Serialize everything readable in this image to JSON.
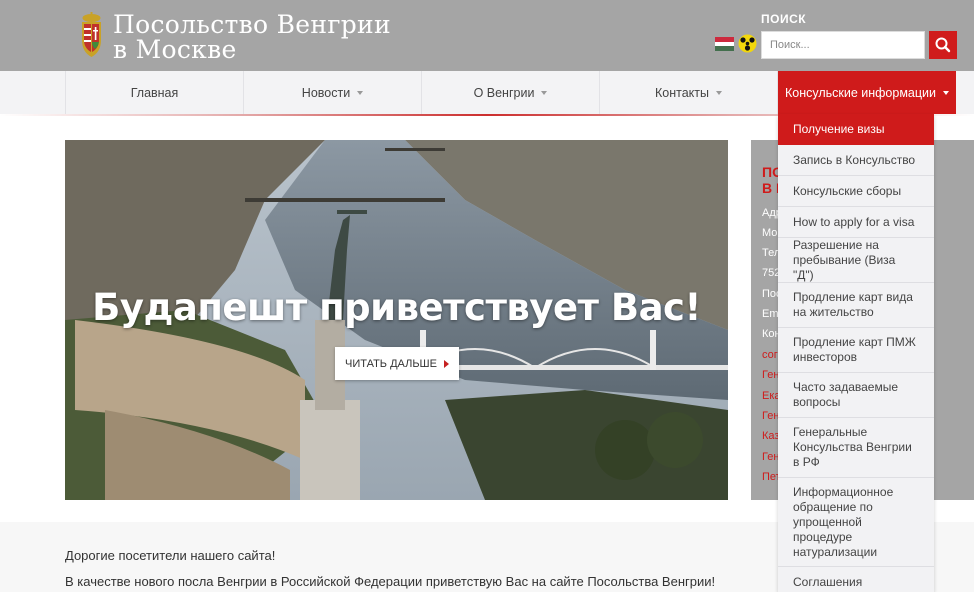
{
  "header": {
    "title_line1": "Посольство Венгрии",
    "title_line2": "в Москве",
    "search_label": "ПОИСК",
    "search_placeholder": "Поиск..."
  },
  "nav": {
    "items": [
      {
        "label": "Главная"
      },
      {
        "label": "Новости"
      },
      {
        "label": "О Венгрии"
      },
      {
        "label": "Контакты"
      },
      {
        "label": "Консульские информации"
      }
    ]
  },
  "hero": {
    "caption": "Будапешт приветствует Вас!",
    "button_label": "ЧИТАТЬ ДАЛЬШЕ"
  },
  "sidebar": {
    "heading_line1": "ПО",
    "heading_line2": "В I",
    "lines": [
      "Адр",
      "Мо",
      "Тел",
      "752",
      "Пос",
      "Em",
      "Кон"
    ],
    "red_lines": [
      "сог",
      "Ген",
      "Ека",
      "Ген",
      "Каз",
      "Ген",
      "Пет"
    ]
  },
  "dropdown": {
    "items": [
      "Получение визы",
      "Запись в Консульство",
      "Консульские сборы",
      "How to apply for a visa",
      "Разрешение на пребывание (Виза \"Д\")",
      "Продление карт вида на жительство",
      "Продление карт ПМЖ инвесторов",
      "Часто задаваемые вопросы",
      "Генеральные Консульства Венгрии в РФ",
      "Информационное обращение по упрощенной процедуре натурализации",
      "Соглашения"
    ]
  },
  "content": {
    "greeting": "Дорогие посетители нашего сайта!",
    "intro": "В качестве нового посла Венгрии в Российской Федерации приветствую Вас на сайте Посольства Венгрии!"
  },
  "colors": {
    "header_bg": "#a5a5a5",
    "accent_red": "#cf1b1b",
    "nav_bg": "#f3f3f5"
  }
}
